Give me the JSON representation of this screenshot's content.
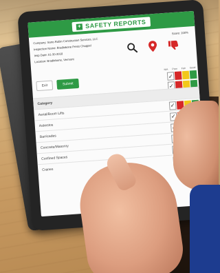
{
  "app": {
    "brand": "SAFETY REPORTS",
    "brand_mark": "+"
  },
  "report": {
    "company": "Company: Sano-Rubin Construction Services, LLC",
    "inspection": "Inspection Name: Bradlebone Press Chappel",
    "date": "Insp Date: 01-30-2018",
    "location": "Location: Bradlebone, Vermont",
    "score": "Score: 100%"
  },
  "actions": {
    "exit_label": "Exit",
    "submit_label": "Submit"
  },
  "columns": [
    "N/A",
    "Poor",
    "Fair",
    "Good"
  ],
  "items": [
    {
      "label": "Category",
      "type": "category"
    },
    {
      "label": "Aerial/Boom Lifts",
      "type": "item"
    },
    {
      "label": "Asbestos",
      "type": "item"
    },
    {
      "label": "Barricades",
      "type": "item"
    },
    {
      "label": "Concrete/Masonry",
      "type": "item"
    },
    {
      "label": "Confined Spaces",
      "type": "item"
    },
    {
      "label": "Cranes",
      "type": "item"
    }
  ],
  "colors": {
    "brand_green": "#2e9a45",
    "poor": "#d62828",
    "fair": "#f2c81a",
    "good": "#2e9a45"
  },
  "icons": [
    "search-icon",
    "location-pin-icon",
    "thumbs-down-icon"
  ]
}
